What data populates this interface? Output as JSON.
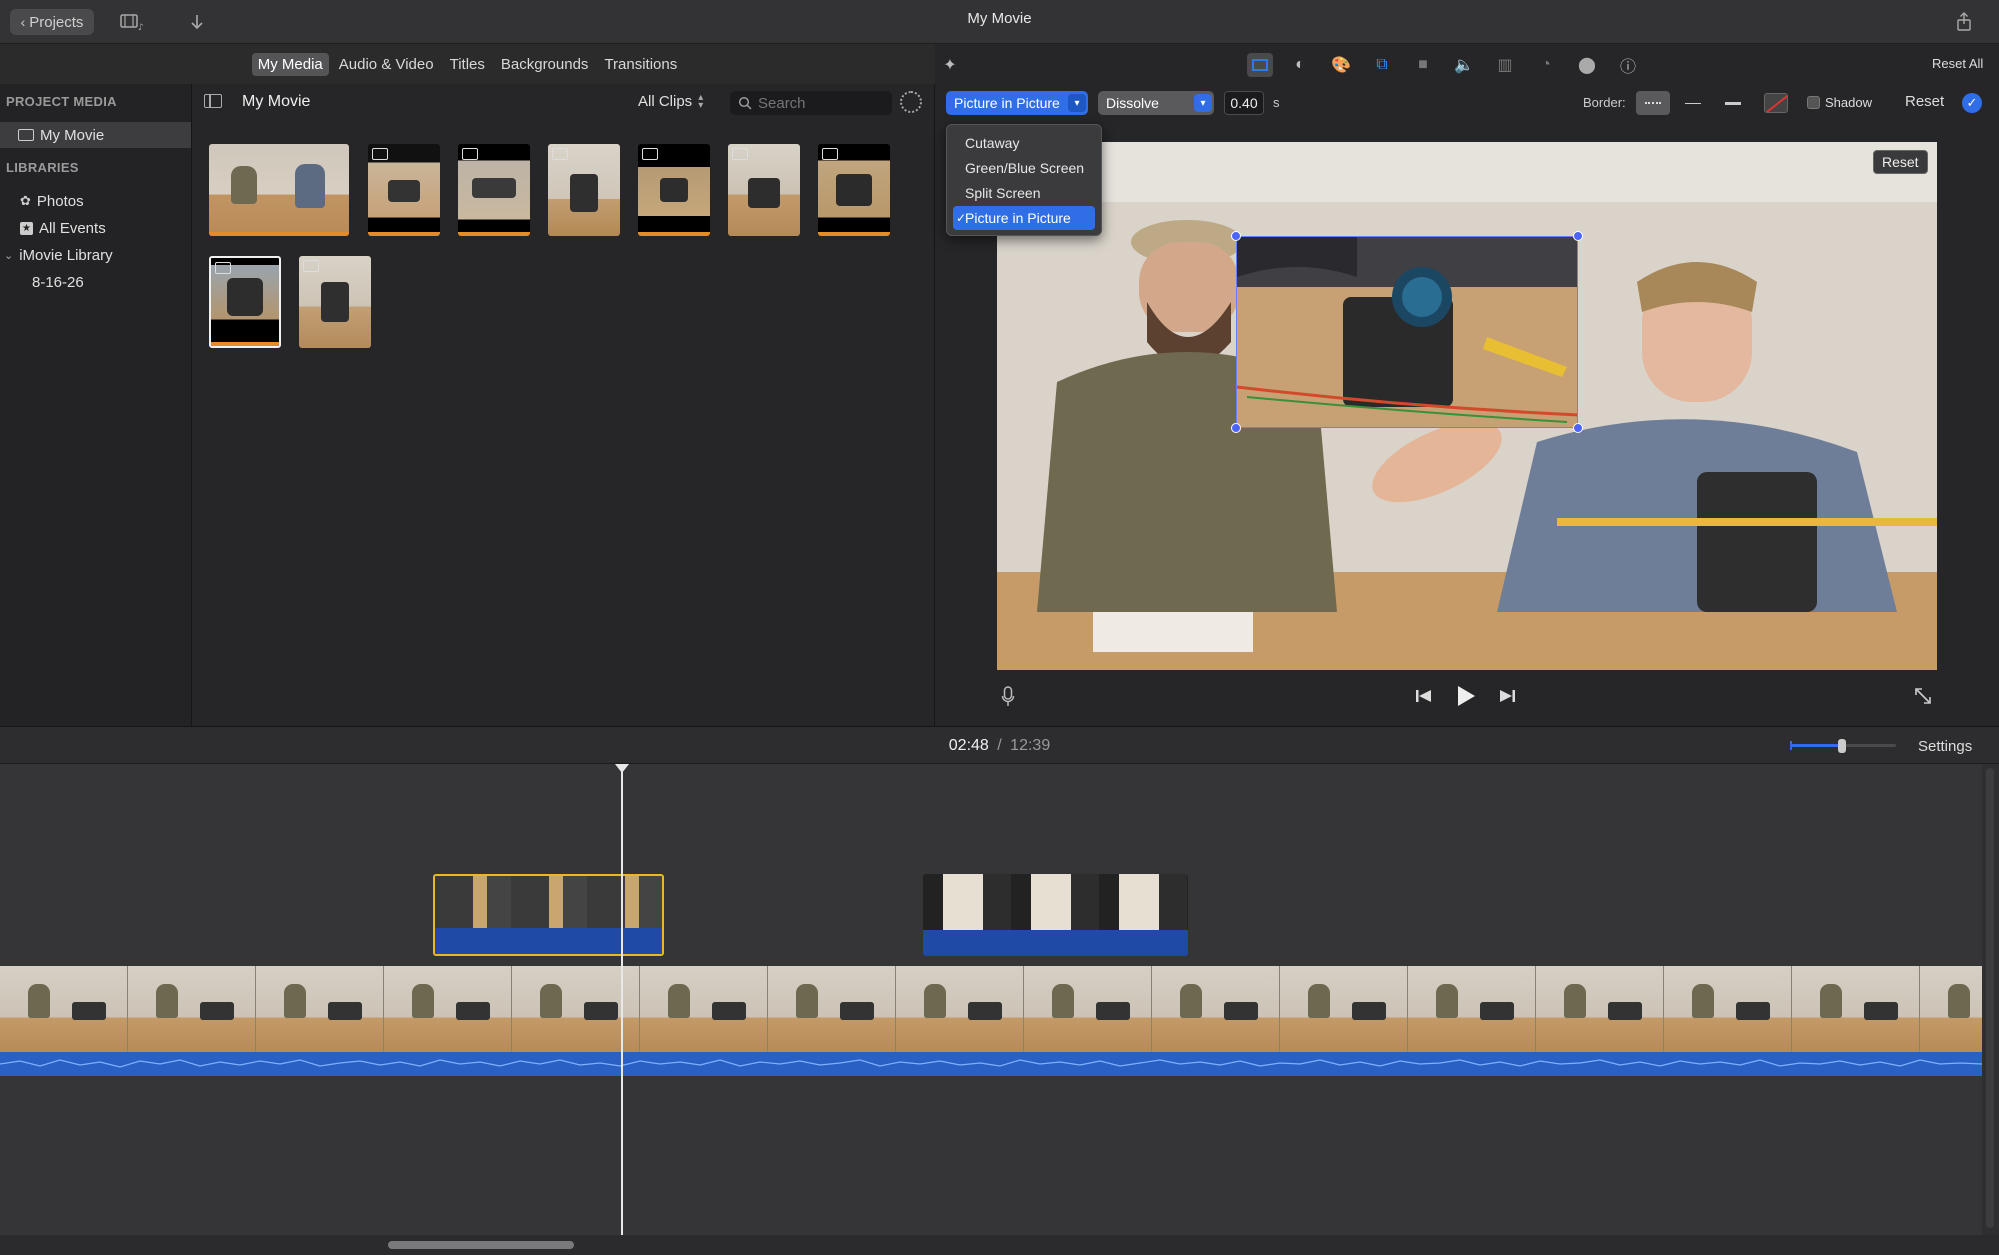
{
  "titlebar": {
    "projects_label": "Projects",
    "window_title": "My Movie"
  },
  "media_tabs": [
    {
      "label": "My Media",
      "active": true
    },
    {
      "label": "Audio & Video",
      "active": false
    },
    {
      "label": "Titles",
      "active": false
    },
    {
      "label": "Backgrounds",
      "active": false
    },
    {
      "label": "Transitions",
      "active": false
    }
  ],
  "sidebar": {
    "project_media_heading": "PROJECT MEDIA",
    "project_item": "My Movie",
    "libraries_heading": "LIBRARIES",
    "photos": "Photos",
    "all_events": "All Events",
    "library": "iMovie Library",
    "event": "8-16-26"
  },
  "browser": {
    "title": "My Movie",
    "filter": "All Clips",
    "search_placeholder": "Search"
  },
  "viewer": {
    "reset_all": "Reset All",
    "overlay_mode": "Picture in Picture",
    "transition": "Dissolve",
    "duration": "0.40",
    "duration_unit": "s",
    "border_label": "Border:",
    "shadow_label": "Shadow",
    "reset_label": "Reset",
    "preview_reset": "Reset",
    "overlay_options": [
      "Cutaway",
      "Green/Blue Screen",
      "Split Screen",
      "Picture in Picture"
    ],
    "selected_option": "Picture in Picture",
    "check_mark": "✓"
  },
  "timeline": {
    "current_time": "02:48",
    "separator": "/",
    "total_time": "12:39",
    "settings_label": "Settings"
  },
  "colors": {
    "accent": "#2f6ee6",
    "selection_border": "#e8b923",
    "audio_wave": "#2a5fc4"
  }
}
